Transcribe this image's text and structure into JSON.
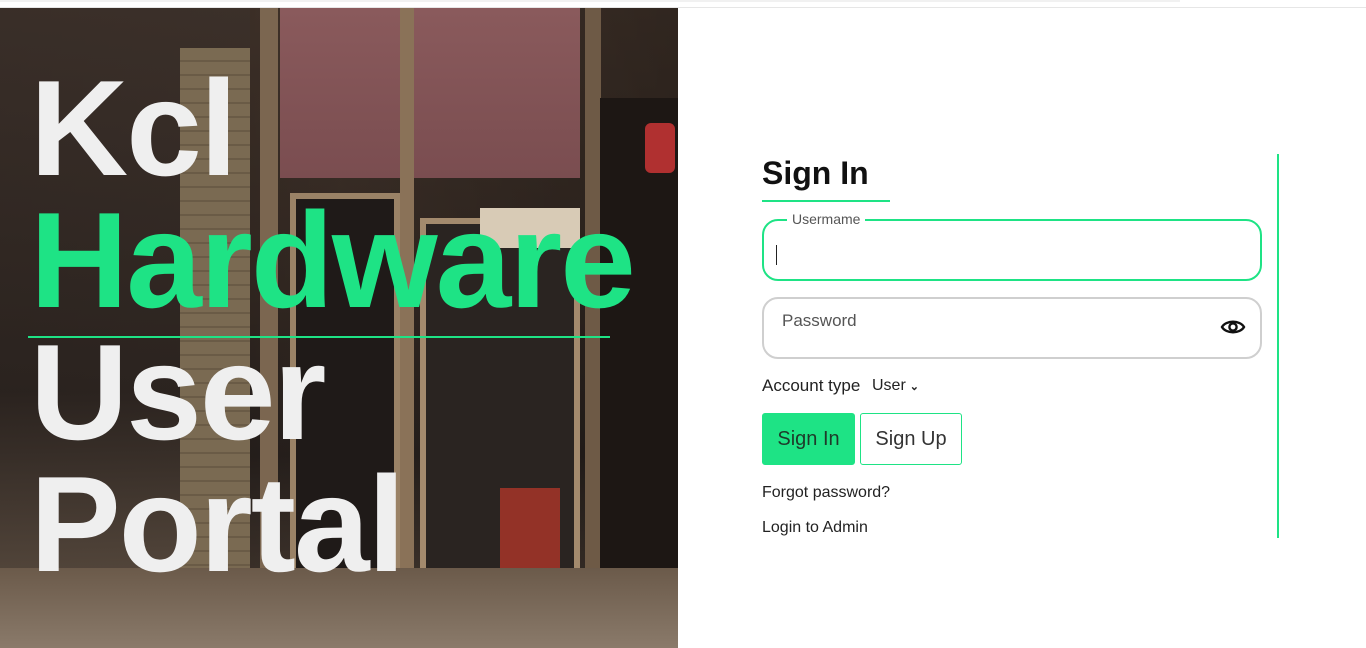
{
  "hero": {
    "line1": "Kcl",
    "line2": "Hardware",
    "line3": "User",
    "line4": "Portal",
    "accent_color": "#1ee385"
  },
  "form": {
    "title": "Sign In",
    "username_label": "Usermame",
    "password_placeholder": "Password",
    "account_type_label": "Account type",
    "account_type_value": "User",
    "signin_button": "Sign In",
    "signup_button": "Sign Up",
    "forgot_link": "Forgot password?",
    "admin_link": "Login to Admin",
    "eye_icon": "eye-icon"
  },
  "colors": {
    "accent": "#1ee385",
    "text": "#222222"
  }
}
